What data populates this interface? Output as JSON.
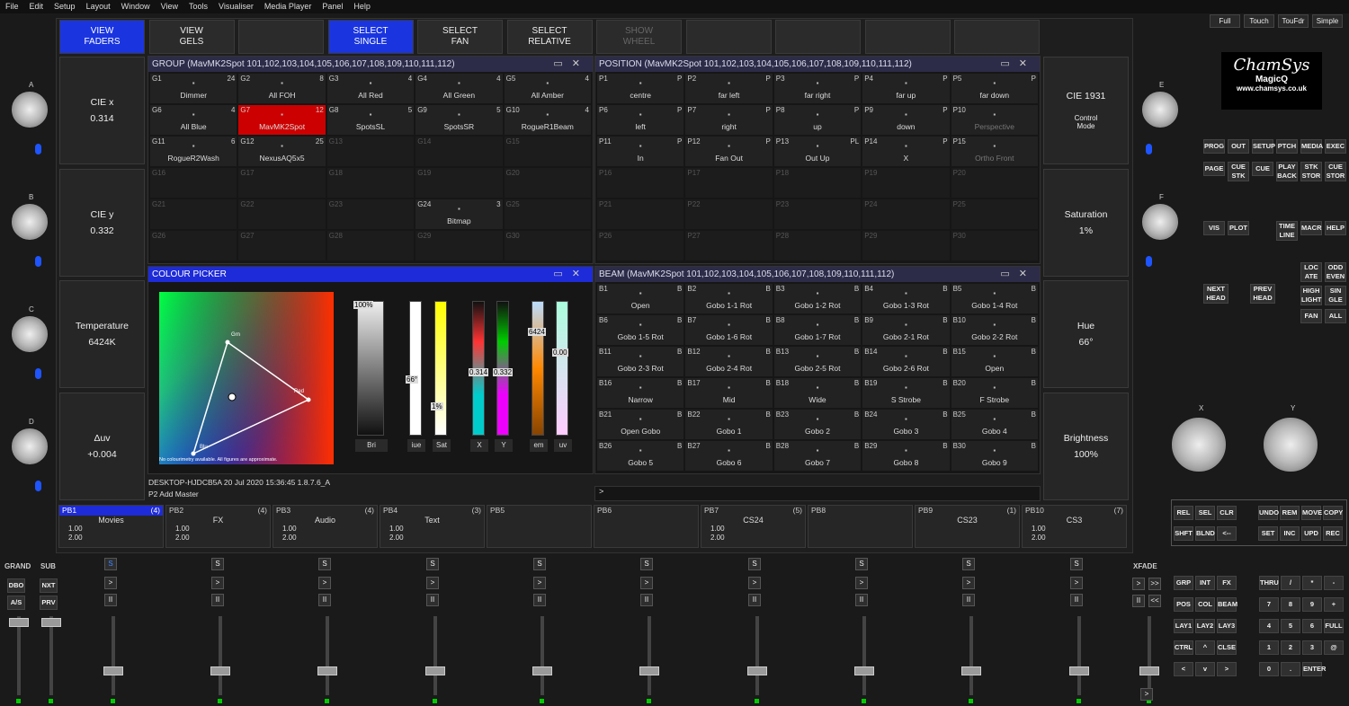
{
  "menu": [
    "File",
    "Edit",
    "Setup",
    "Layout",
    "Window",
    "View",
    "Tools",
    "Visualiser",
    "Media Player",
    "Panel",
    "Help"
  ],
  "top_right_buttons": [
    "Full",
    "Touch",
    "TouFdr",
    "Simple"
  ],
  "top_buttons": [
    "VIEW\nFADERS",
    "VIEW\nGELS",
    "",
    "SELECT\nSINGLE",
    "SELECT\nFAN",
    "SELECT\nRELATIVE",
    "SHOW\nWHEEL",
    "",
    "",
    "",
    ""
  ],
  "left_side": [
    {
      "label": "CIE x",
      "value": "0.314"
    },
    {
      "label": "CIE y",
      "value": "0.332"
    },
    {
      "label": "Temperature",
      "value": "6424K"
    },
    {
      "label": "Δuv",
      "value": "+0.004"
    }
  ],
  "right_side": [
    {
      "label": "CIE 1931",
      "value": ""
    },
    {
      "label": "Saturation",
      "value": "1%"
    },
    {
      "label": "Hue",
      "value": "66°"
    },
    {
      "label": "Brightness",
      "value": "100%"
    }
  ],
  "control_mode": "Control\nMode",
  "knob_labels": {
    "left": [
      "A",
      "B",
      "C",
      "D"
    ],
    "right": [
      "E",
      "F"
    ],
    "xy": [
      "X",
      "Y"
    ]
  },
  "group_window": {
    "title": "GROUP (MavMK2Spot 101,102,103,104,105,106,107,108,109,110,111,112)",
    "cells": [
      [
        "G1",
        "24",
        "Dimmer"
      ],
      [
        "G2",
        "8",
        "All FOH"
      ],
      [
        "G3",
        "4",
        "All Red"
      ],
      [
        "G4",
        "4",
        "All Green"
      ],
      [
        "G5",
        "4",
        "All Amber"
      ],
      [
        "G6",
        "4",
        "All Blue"
      ],
      [
        "G7",
        "12",
        "MavMK2Spot"
      ],
      [
        "G8",
        "5",
        "SpotsSL"
      ],
      [
        "G9",
        "5",
        "SpotsSR"
      ],
      [
        "G10",
        "4",
        "RogueR1Beam"
      ],
      [
        "G11",
        "6",
        "RogueR2Wash"
      ],
      [
        "G12",
        "25",
        "NexusAQ5x5"
      ],
      [
        "G13",
        "",
        ""
      ],
      [
        "G14",
        "",
        ""
      ],
      [
        "G15",
        "",
        ""
      ],
      [
        "G16",
        "",
        ""
      ],
      [
        "G17",
        "",
        ""
      ],
      [
        "G18",
        "",
        ""
      ],
      [
        "G19",
        "",
        ""
      ],
      [
        "G20",
        "",
        ""
      ],
      [
        "G21",
        "",
        ""
      ],
      [
        "G22",
        "",
        ""
      ],
      [
        "G23",
        "",
        ""
      ],
      [
        "G24",
        "3",
        "Bitmap"
      ],
      [
        "G25",
        "",
        ""
      ],
      [
        "G26",
        "",
        ""
      ],
      [
        "G27",
        "",
        ""
      ],
      [
        "G28",
        "",
        ""
      ],
      [
        "G29",
        "",
        ""
      ],
      [
        "G30",
        "",
        ""
      ]
    ]
  },
  "position_window": {
    "title": "POSITION (MavMK2Spot 101,102,103,104,105,106,107,108,109,110,111,112)",
    "cells": [
      [
        "P1",
        "P",
        "centre"
      ],
      [
        "P2",
        "P",
        "far left"
      ],
      [
        "P3",
        "P",
        "far right"
      ],
      [
        "P4",
        "P",
        "far up"
      ],
      [
        "P5",
        "P",
        "far down"
      ],
      [
        "P6",
        "P",
        "left"
      ],
      [
        "P7",
        "P",
        "right"
      ],
      [
        "P8",
        "P",
        "up"
      ],
      [
        "P9",
        "P",
        "down"
      ],
      [
        "P10",
        "",
        "Perspective"
      ],
      [
        "P11",
        "P",
        "In"
      ],
      [
        "P12",
        "P",
        "Fan Out"
      ],
      [
        "P13",
        "PL",
        "Out Up"
      ],
      [
        "P14",
        "P",
        "X"
      ],
      [
        "P15",
        "",
        "Ortho Front"
      ],
      [
        "P16",
        "",
        ""
      ],
      [
        "P17",
        "",
        ""
      ],
      [
        "P18",
        "",
        ""
      ],
      [
        "P19",
        "",
        ""
      ],
      [
        "P20",
        "",
        ""
      ],
      [
        "P21",
        "",
        ""
      ],
      [
        "P22",
        "",
        ""
      ],
      [
        "P23",
        "",
        ""
      ],
      [
        "P24",
        "",
        ""
      ],
      [
        "P25",
        "",
        ""
      ],
      [
        "P26",
        "",
        ""
      ],
      [
        "P27",
        "",
        ""
      ],
      [
        "P28",
        "",
        ""
      ],
      [
        "P29",
        "",
        ""
      ],
      [
        "P30",
        "",
        ""
      ]
    ]
  },
  "colour_picker": {
    "title": "COLOUR PICKER",
    "note": "No colourimetry available. All figures are approximate.",
    "sliders": [
      {
        "label": "Bri",
        "value": "100%"
      },
      {
        "label": "iue",
        "value": "66°"
      },
      {
        "label": "Sat",
        "value": "1%"
      },
      {
        "label": "X",
        "value": "0.314"
      },
      {
        "label": "Y",
        "value": "0.332"
      },
      {
        "label": "em",
        "value": "6424"
      },
      {
        "label": "uv",
        "value": "0.00"
      }
    ],
    "points": [
      "Grn",
      "Red",
      "Blu"
    ]
  },
  "beam_window": {
    "title": "BEAM (MavMK2Spot 101,102,103,104,105,106,107,108,109,110,111,112)",
    "cells": [
      [
        "B1",
        "B",
        "Open"
      ],
      [
        "B2",
        "B",
        "Gobo 1-1 Rot"
      ],
      [
        "B3",
        "B",
        "Gobo 1-2 Rot"
      ],
      [
        "B4",
        "B",
        "Gobo 1-3 Rot"
      ],
      [
        "B5",
        "B",
        "Gobo 1-4 Rot"
      ],
      [
        "B6",
        "B",
        "Gobo 1-5 Rot"
      ],
      [
        "B7",
        "B",
        "Gobo 1-6 Rot"
      ],
      [
        "B8",
        "B",
        "Gobo 1-7 Rot"
      ],
      [
        "B9",
        "B",
        "Gobo 2-1 Rot"
      ],
      [
        "B10",
        "B",
        "Gobo 2-2 Rot"
      ],
      [
        "B11",
        "B",
        "Gobo 2-3 Rot"
      ],
      [
        "B12",
        "B",
        "Gobo 2-4 Rot"
      ],
      [
        "B13",
        "B",
        "Gobo 2-5 Rot"
      ],
      [
        "B14",
        "B",
        "Gobo 2-6 Rot"
      ],
      [
        "B15",
        "B",
        "Open"
      ],
      [
        "B16",
        "B",
        "Narrow"
      ],
      [
        "B17",
        "B",
        "Mid"
      ],
      [
        "B18",
        "B",
        "Wide"
      ],
      [
        "B19",
        "B",
        "S Strobe"
      ],
      [
        "B20",
        "B",
        "F Strobe"
      ],
      [
        "B21",
        "B",
        "Open Gobo"
      ],
      [
        "B22",
        "B",
        "Gobo 1"
      ],
      [
        "B23",
        "B",
        "Gobo 2"
      ],
      [
        "B24",
        "B",
        "Gobo 3"
      ],
      [
        "B25",
        "B",
        "Gobo 4"
      ],
      [
        "B26",
        "B",
        "Gobo 5"
      ],
      [
        "B27",
        "B",
        "Gobo 6"
      ],
      [
        "B28",
        "B",
        "Gobo 7"
      ],
      [
        "B29",
        "B",
        "Gobo 8"
      ],
      [
        "B30",
        "B",
        "Gobo 9"
      ]
    ]
  },
  "status": {
    "line1": "DESKTOP-HJDCB5A 20 Jul 2020 15:36:45 1.8.7.6_A",
    "line2": "P2  Add Master",
    "cmd": ">"
  },
  "playbacks": [
    {
      "id": "PB1",
      "count": "(4)",
      "name": "Movies",
      "v1": "1.00",
      "v2": "2.00"
    },
    {
      "id": "PB2",
      "count": "(4)",
      "name": "FX",
      "v1": "1.00",
      "v2": "2.00"
    },
    {
      "id": "PB3",
      "count": "(4)",
      "name": "Audio",
      "v1": "1.00",
      "v2": "2.00"
    },
    {
      "id": "PB4",
      "count": "(3)",
      "name": "Text",
      "v1": "1.00",
      "v2": "2.00"
    },
    {
      "id": "PB5",
      "count": "",
      "name": "",
      "v1": "",
      "v2": ""
    },
    {
      "id": "PB6",
      "count": "",
      "name": "",
      "v1": "",
      "v2": ""
    },
    {
      "id": "PB7",
      "count": "(5)",
      "name": "CS24",
      "v1": "1.00",
      "v2": "2.00"
    },
    {
      "id": "PB8",
      "count": "",
      "name": "",
      "v1": "",
      "v2": ""
    },
    {
      "id": "PB9",
      "count": "(1)",
      "name": "CS23",
      "v1": "",
      "v2": ""
    },
    {
      "id": "PB10",
      "count": "(7)",
      "name": "CS3",
      "v1": "1.00",
      "v2": "2.00"
    }
  ],
  "logo": {
    "brand": "ChamSys",
    "product": "MagicQ",
    "url": "www.chamsys.co.uk"
  },
  "bottom_left": {
    "grand": "GRAND",
    "sub": "SUB",
    "dbo": "DBO",
    "nxt": "NXT",
    "as": "A/S",
    "prv": "PRV",
    "xfade": "XFADE"
  },
  "fader_buttons": {
    "s": "S",
    "go": ">",
    "pause": "II"
  },
  "right_keys": {
    "row1": [
      "PROG",
      "OUT",
      "SETUP",
      "PTCH",
      "MEDIA",
      "EXEC"
    ],
    "row2": [
      "PAGE",
      "CUE STK",
      "CUE",
      "PLAY BACK",
      "STK STOR",
      "CUE STOR"
    ],
    "row3": [
      "VIS",
      "PLOT",
      "",
      "TIME LINE",
      "MACR",
      "HELP"
    ],
    "locate": [
      "LOC ATE",
      "ODD EVEN",
      "HIGH LIGHT",
      "SIN GLE",
      "FAN",
      "ALL"
    ],
    "nexthead": "NEXT HEAD",
    "prevhead": "PREV HEAD",
    "edit1": [
      "REL",
      "SEL",
      "CLR"
    ],
    "edit2": [
      "SHFT",
      "BLND",
      "<--"
    ],
    "edit3": [
      "UNDO",
      "REM",
      "MOVE",
      "COPY"
    ],
    "edit4": [
      "SET",
      "INC",
      "UPD",
      "REC"
    ],
    "attr": [
      "GRP",
      "INT",
      "FX",
      "POS",
      "COL",
      "BEAM",
      "LAY1",
      "LAY2",
      "LAY3",
      "CTRL",
      "^",
      "CLSE",
      "<",
      "v",
      ">"
    ],
    "numpad": [
      "THRU",
      "/",
      "*",
      "-",
      "7",
      "8",
      "9",
      "+",
      "4",
      "5",
      "6",
      "FULL",
      "1",
      "2",
      "3",
      "@",
      "0",
      ".",
      "ENTER"
    ]
  },
  "colors": {
    "accent_blue": "#1e2bd8",
    "selected_red": "#cc0000",
    "knob_led": "#1e55ff",
    "fader_led": "#00cc00"
  }
}
